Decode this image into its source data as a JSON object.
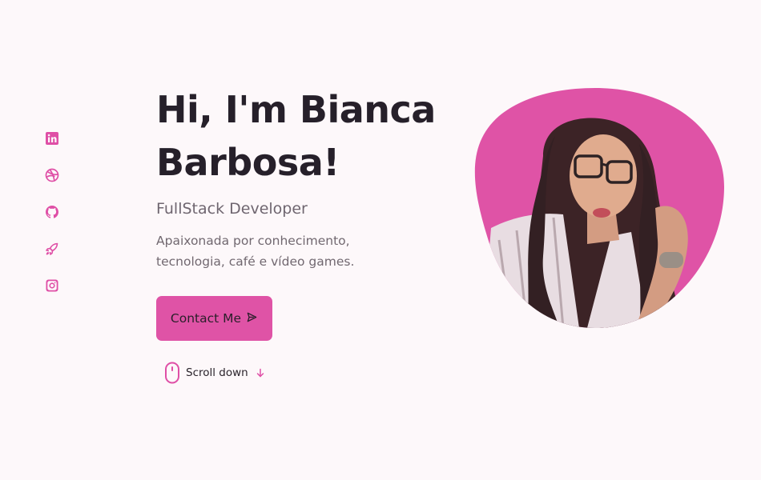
{
  "social": {
    "items": [
      {
        "icon": "linkedin-icon"
      },
      {
        "icon": "dribbble-icon"
      },
      {
        "icon": "github-icon"
      },
      {
        "icon": "rocket-icon"
      },
      {
        "icon": "instagram-icon"
      }
    ]
  },
  "home": {
    "title_line1": "Hi, I'm Bianca",
    "title_line2": "Barbosa!",
    "subtitle": "FullStack Developer",
    "description": "Apaixonada por conhecimento, tecnologia, café e vídeo games.",
    "contact_label": "Contact Me",
    "scroll_label": "Scroll down"
  },
  "colors": {
    "accent": "#df4fa6",
    "blob": "#df53a6",
    "background": "#fdf8fa",
    "title": "#26202a",
    "text": "#716870"
  },
  "profile_image": {
    "shape": "blob"
  }
}
